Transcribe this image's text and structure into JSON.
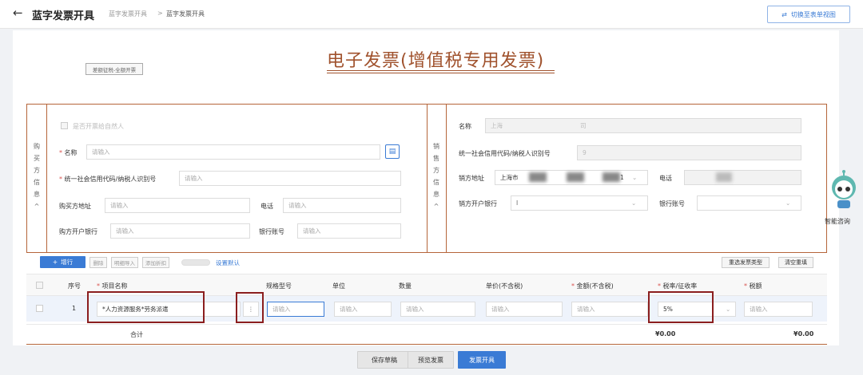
{
  "header": {
    "back_icon": "arrow-left-icon",
    "title": "蓝字发票开具",
    "breadcrumb": [
      "蓝字发票开具",
      ">",
      "蓝字发票开具"
    ],
    "switch_button": "切换至表单视图"
  },
  "invoice": {
    "title": "电子发票(增值税专用发票)",
    "tag": "差额征税-全额开票"
  },
  "buyer": {
    "side_label": [
      "购",
      "买",
      "方",
      "信",
      "息",
      "^"
    ],
    "natural_person_checkbox": "是否开票给自然人",
    "name_label": "名称",
    "name_placeholder": "请输入",
    "tax_id_label": "统一社会信用代码/纳税人识别号",
    "tax_id_placeholder": "请输入",
    "address_label": "购买方地址",
    "address_placeholder": "请输入",
    "phone_label": "电话",
    "phone_placeholder": "请输入",
    "bank_label": "购方开户银行",
    "bank_placeholder": "请输入",
    "account_label": "银行账号",
    "account_placeholder": "请输入"
  },
  "seller": {
    "side_label": [
      "销",
      "售",
      "方",
      "信",
      "息",
      "^"
    ],
    "name_label": "名称",
    "name_value": "上海",
    "name_suffix": "司",
    "tax_id_label": "统一社会信用代码/纳税人识别号",
    "tax_id_value": "9",
    "address_label": "销方地址",
    "address_value": "上海市",
    "address_suffix": "1",
    "phone_label": "电话",
    "bank_label": "销方开户银行",
    "bank_value": "I",
    "account_label": "银行账号"
  },
  "toolbar": {
    "add_row": "增行",
    "delete": "删除",
    "import_detail": "明细导入",
    "add_discount": "添加折扣",
    "set_default": "设置默认",
    "reselect_type": "重选发票类型",
    "clear_all": "清空重填"
  },
  "table": {
    "headers": [
      "序号",
      "项目名称",
      "规格型号",
      "单位",
      "数量",
      "单价(不含税)",
      "金额(不含税)",
      "税率/征收率",
      "税额"
    ],
    "rows": [
      {
        "index": "1",
        "item_name": "*人力资源服务*劳务派遣",
        "spec": "请输入",
        "unit": "请输入",
        "qty": "请输入",
        "price": "请输入",
        "amount": "请输入",
        "rate": "5%",
        "tax": "请输入"
      }
    ],
    "sum_label": "合计",
    "sum_amount": "¥0.00",
    "sum_tax": "¥0.00"
  },
  "footer": {
    "save_draft": "保存草稿",
    "preview": "预览发票",
    "issue": "发票开具"
  },
  "assistant": {
    "label": "智能咨询"
  }
}
